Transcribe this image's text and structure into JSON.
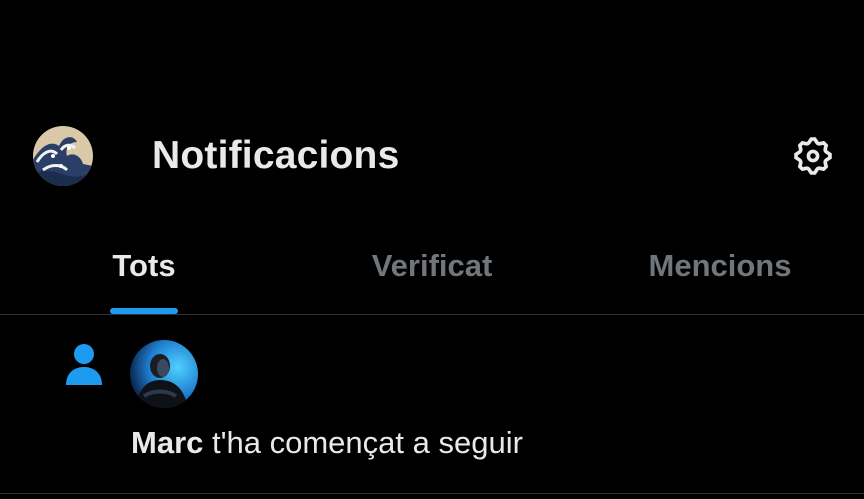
{
  "header": {
    "title": "Notificacions",
    "avatar_icon": "wave-art-avatar",
    "settings_icon": "gear-icon"
  },
  "tabs": [
    {
      "label": "Tots",
      "active": true
    },
    {
      "label": "Verificat",
      "active": false
    },
    {
      "label": "Mencions",
      "active": false
    }
  ],
  "notifications": [
    {
      "type": "follow",
      "icon": "person-icon",
      "user_name": "Marc",
      "message": " t'ha començat a seguir"
    }
  ],
  "colors": {
    "background": "#000000",
    "text_primary": "#e7e9ea",
    "text_secondary": "#71767b",
    "accent": "#1d9bf0",
    "divider": "#2f3336"
  }
}
